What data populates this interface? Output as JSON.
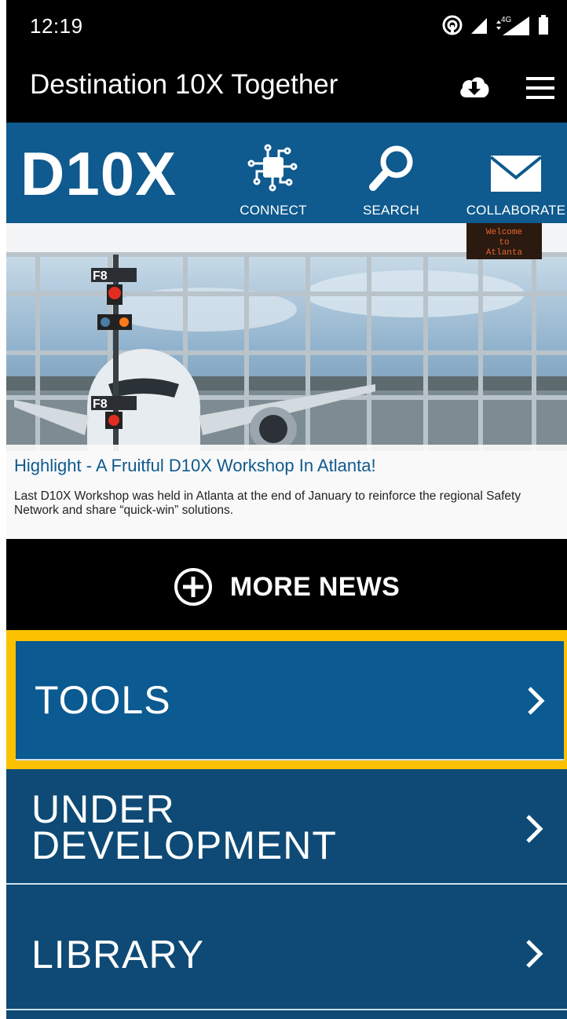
{
  "status_bar": {
    "time": "12:19",
    "network": "4G"
  },
  "app_bar": {
    "title": "Destination 10X Together",
    "download_icon": "cloud-download-icon",
    "menu_icon": "hamburger-menu-icon"
  },
  "brand": {
    "logo": "D10X",
    "color": "#0f5a8e",
    "nav": [
      {
        "label": "CONNECT",
        "icon": "circuit-chip-icon"
      },
      {
        "label": "SEARCH",
        "icon": "magnifier-icon"
      },
      {
        "label": "COLLABORATE",
        "icon": "envelope-icon"
      }
    ]
  },
  "news": {
    "headline": "Highlight - A Fruitful D10X Workshop In Atlanta!",
    "summary": "Last D10X Workshop was held in Atlanta at the end of January to reinforce the regional Safety Network and share “quick-win” solutions.",
    "sign_text": "Welcome to Atlanta",
    "gate_label": "F8"
  },
  "more_news": {
    "label": "MORE NEWS",
    "icon": "plus-circle-icon"
  },
  "menu": [
    {
      "label": "TOOLS",
      "highlighted": true
    },
    {
      "label_line1": "UNDER",
      "label_line2": "DEVELOPMENT"
    },
    {
      "label": "LIBRARY"
    }
  ],
  "colors": {
    "highlight": "#fbc100",
    "tile": "#0e4a75",
    "tile_selected": "#0b5a91"
  }
}
